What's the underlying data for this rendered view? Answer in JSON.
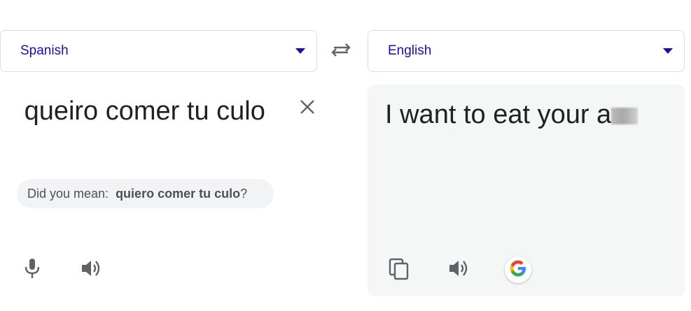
{
  "source": {
    "language": "Spanish",
    "text": " queiro comer tu culo",
    "did_you_mean_prefix": "Did you mean:",
    "did_you_mean_suggestion": "quiero comer tu culo",
    "did_you_mean_suffix": "?"
  },
  "target": {
    "language": "English",
    "text": "I want to eat your a"
  },
  "icons": {
    "swap": "swap-languages-icon",
    "clear": "close-icon",
    "mic": "microphone-icon",
    "listen_source": "speaker-icon",
    "copy": "copy-icon",
    "listen_target": "speaker-icon",
    "google": "google-logo-icon",
    "dropdown": "caret-down-icon"
  },
  "colors": {
    "language_label": "#1a0dab",
    "icon_gray": "#5f6368",
    "panel_bg": "#f5f7f7",
    "suggestion_bg": "#f1f3f4"
  }
}
